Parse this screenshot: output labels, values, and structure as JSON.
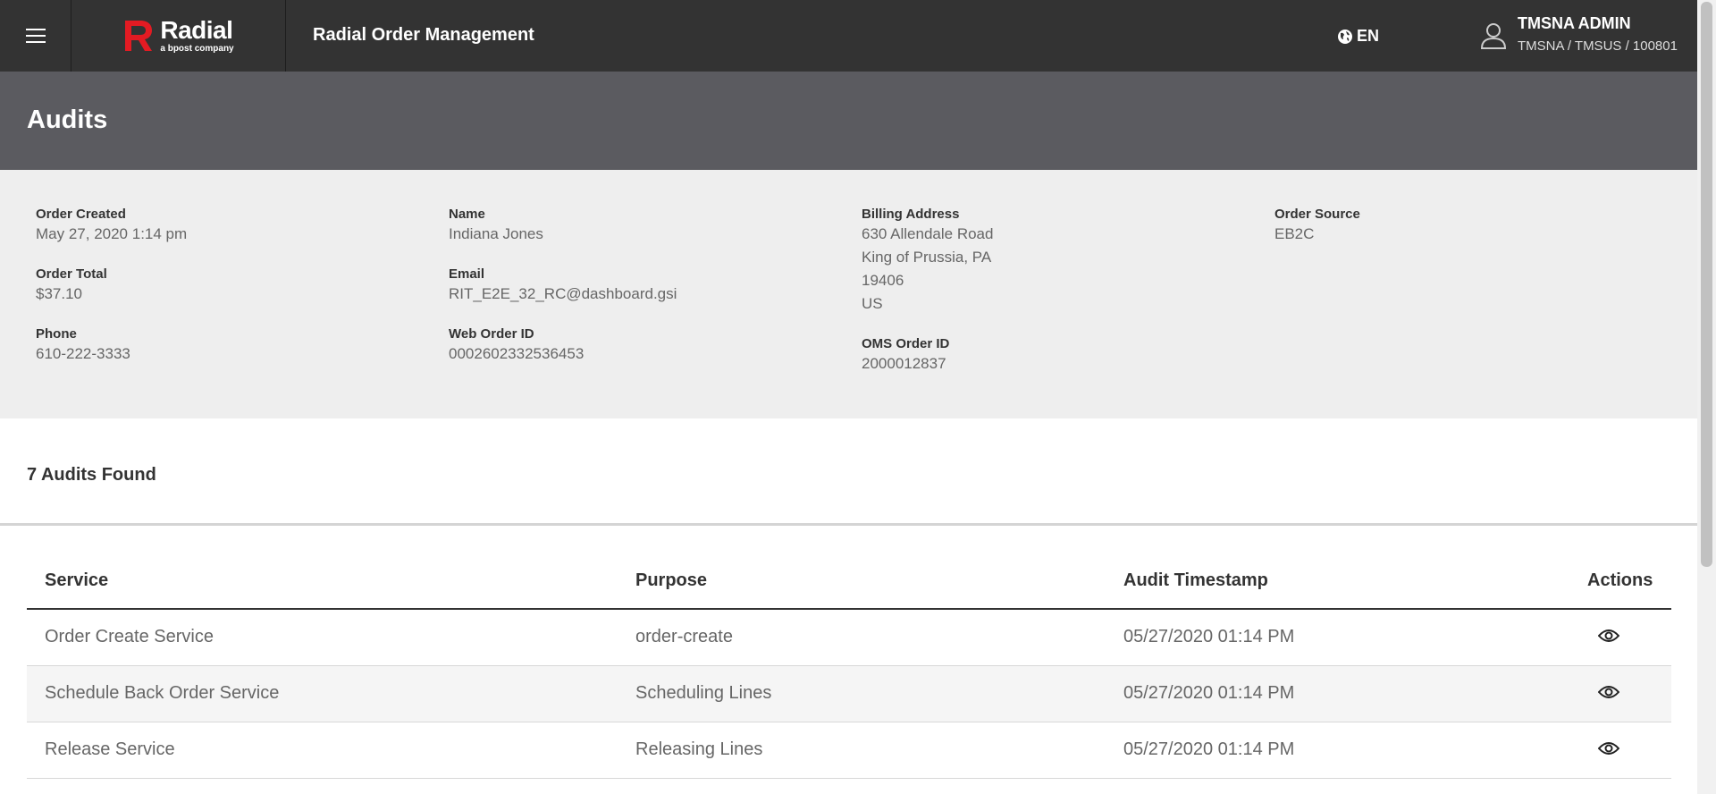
{
  "header": {
    "logo_name": "Radial",
    "logo_sub": "a bpost company",
    "app_title": "Radial Order Management",
    "language": "EN",
    "user_name": "TMSNA ADMIN",
    "user_org": "TMSNA / TMSUS / 100801"
  },
  "page": {
    "title": "Audits"
  },
  "summary": {
    "order_created": {
      "label": "Order Created",
      "value": "May 27, 2020 1:14 pm"
    },
    "order_total": {
      "label": "Order Total",
      "value": "$37.10"
    },
    "phone": {
      "label": "Phone",
      "value": "610-222-3333"
    },
    "name": {
      "label": "Name",
      "value": "Indiana Jones"
    },
    "email": {
      "label": "Email",
      "value": "RIT_E2E_32_RC@dashboard.gsi"
    },
    "web_order_id": {
      "label": "Web Order ID",
      "value": "0002602332536453"
    },
    "billing_address": {
      "label": "Billing Address",
      "lines": [
        "630 Allendale Road",
        "King of Prussia, PA",
        "19406",
        "US"
      ]
    },
    "oms_order_id": {
      "label": "OMS Order ID",
      "value": "2000012837"
    },
    "order_source": {
      "label": "Order Source",
      "value": "EB2C"
    }
  },
  "audits": {
    "found_label": "7 Audits Found",
    "columns": {
      "service": "Service",
      "purpose": "Purpose",
      "timestamp": "Audit Timestamp",
      "actions": "Actions"
    },
    "rows": [
      {
        "service": "Order Create Service",
        "purpose": "order-create",
        "timestamp": "05/27/2020 01:14 PM"
      },
      {
        "service": "Schedule Back Order Service",
        "purpose": "Scheduling Lines",
        "timestamp": "05/27/2020 01:14 PM"
      },
      {
        "service": "Release Service",
        "purpose": "Releasing Lines",
        "timestamp": "05/27/2020 01:14 PM"
      }
    ]
  },
  "icons": {
    "menu": "hamburger-icon",
    "lang": "globe-icon",
    "user": "user-icon",
    "view": "eye-icon"
  },
  "colors": {
    "topbar": "#333333",
    "header": "#5b5b60",
    "summary_bg": "#eeeeee",
    "brand_red": "#e31b23"
  }
}
